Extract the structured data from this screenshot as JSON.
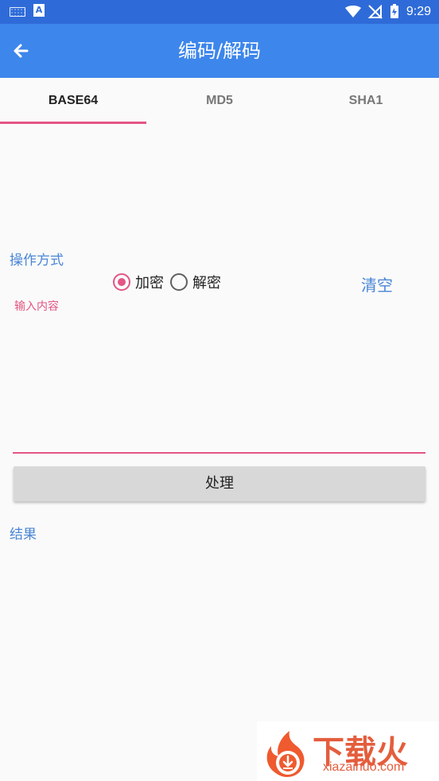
{
  "status_bar": {
    "time": "9:29"
  },
  "app_bar": {
    "title": "编码/解码"
  },
  "tabs": [
    {
      "label": "BASE64"
    },
    {
      "label": "MD5"
    },
    {
      "label": "SHA1"
    }
  ],
  "form": {
    "operation_label": "操作方式",
    "radio_encrypt": "加密",
    "radio_decrypt": "解密",
    "clear_label": "清空",
    "input_label": "输入内容",
    "process_label": "处理",
    "result_label": "结果"
  },
  "watermark": {
    "main": "下载火",
    "site": "xiazaihuo.com"
  },
  "colors": {
    "app_bar": "#3d86eb",
    "accent": "#e45582",
    "link": "#4a86d6"
  }
}
